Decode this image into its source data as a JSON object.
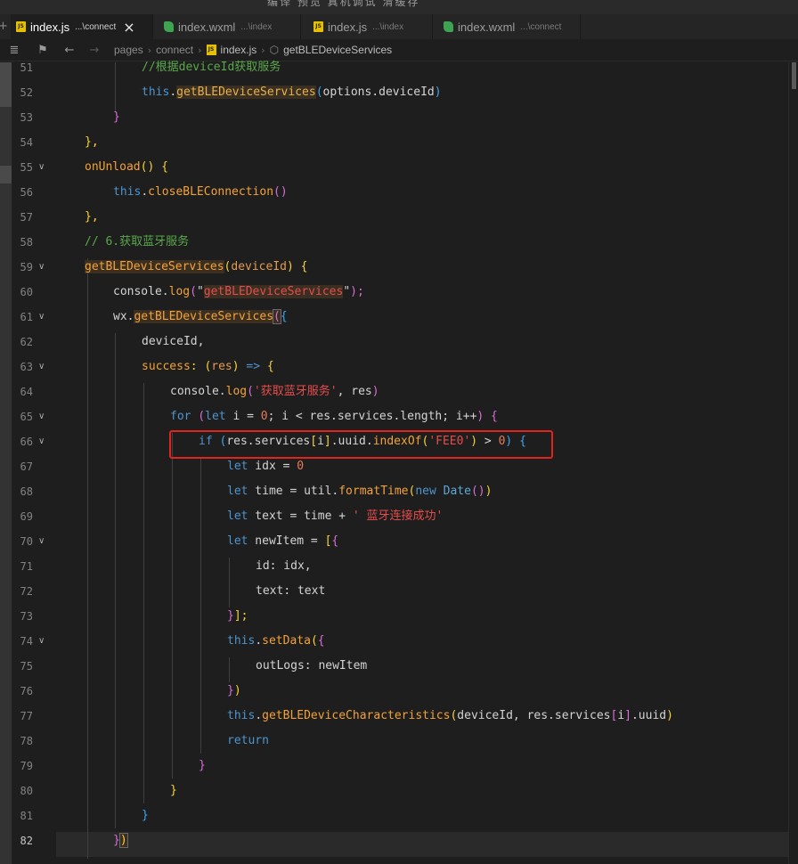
{
  "titlebar": {
    "text": "编译   预览   真机调试  清缓存"
  },
  "tabs": [
    {
      "name": "index.js",
      "path": "...\\connect",
      "icon": "js",
      "close": "×"
    },
    {
      "name": "index.wxml",
      "path": "...\\index",
      "icon": "wxml"
    },
    {
      "name": "index.js",
      "path": "...\\index",
      "icon": "js"
    },
    {
      "name": "index.wxml",
      "path": "...\\connect",
      "icon": "wxml"
    }
  ],
  "breadcrumb": {
    "segments": [
      "pages",
      "connect",
      "index.js"
    ],
    "symbol": "getBLEDeviceServices",
    "separator": "›"
  },
  "icons": {
    "js_badge": "JS",
    "back": "←",
    "forward": "→",
    "bookmark": "⚑",
    "menu": "≣",
    "plus": "+",
    "fold": "∨",
    "cube": "⬡"
  },
  "editor": {
    "current_line": 82,
    "line_numbers": [
      51,
      52,
      53,
      54,
      55,
      56,
      57,
      58,
      59,
      60,
      61,
      62,
      63,
      64,
      65,
      66,
      67,
      68,
      69,
      70,
      71,
      72,
      73,
      74,
      75,
      76,
      77,
      78,
      79,
      80,
      81,
      82
    ],
    "lines": [
      [
        {
          "t": "//根据deviceId获取服务",
          "c": "cm"
        }
      ],
      [
        {
          "t": "this",
          "c": "kw"
        },
        {
          "t": ".",
          "c": "df"
        },
        {
          "t": "getBLEDeviceServices",
          "c": "fn",
          "h": "sym"
        },
        {
          "t": "(",
          "c": "b3"
        },
        {
          "t": "options.deviceId",
          "c": "df"
        },
        {
          "t": ")",
          "c": "b3"
        }
      ],
      [
        {
          "t": "}",
          "c": "b2"
        }
      ],
      [
        {
          "t": "},",
          "c": "b1"
        }
      ],
      [
        {
          "t": "onUnload",
          "c": "ty"
        },
        {
          "t": "() {",
          "c": "b1"
        }
      ],
      [
        {
          "t": "this",
          "c": "kw"
        },
        {
          "t": ".",
          "c": "df"
        },
        {
          "t": "closeBLEConnection",
          "c": "ty"
        },
        {
          "t": "()",
          "c": "b2"
        }
      ],
      [
        {
          "t": "},",
          "c": "b1"
        }
      ],
      [
        {
          "t": "// 6.获取蓝牙服务",
          "c": "cm"
        }
      ],
      [
        {
          "t": "getBLEDeviceServices",
          "c": "ty",
          "h": "sym"
        },
        {
          "t": "(",
          "c": "b1"
        },
        {
          "t": "deviceId",
          "c": "pm"
        },
        {
          "t": ") {",
          "c": "b1"
        }
      ],
      [
        {
          "t": "console",
          "c": "df"
        },
        {
          "t": ".",
          "c": "df"
        },
        {
          "t": "log",
          "c": "ty"
        },
        {
          "t": "(",
          "c": "b2"
        },
        {
          "t": "\"",
          "c": "df"
        },
        {
          "t": "getBLEDeviceServices",
          "c": "st",
          "h": "sym"
        },
        {
          "t": "\"",
          "c": "df"
        },
        {
          "t": ");",
          "c": "b2"
        }
      ],
      [
        {
          "t": "wx",
          "c": "df"
        },
        {
          "t": ".",
          "c": "df"
        },
        {
          "t": "getBLEDeviceServices",
          "c": "ty",
          "h": "sym"
        },
        {
          "t": "(",
          "c": "b2",
          "h": "br"
        },
        {
          "t": "{",
          "c": "b3"
        }
      ],
      [
        {
          "t": "deviceId,",
          "c": "df"
        }
      ],
      [
        {
          "t": "success",
          "c": "ty"
        },
        {
          "t": ": (",
          "c": "b1"
        },
        {
          "t": "res",
          "c": "pm"
        },
        {
          "t": ") ",
          "c": "b1"
        },
        {
          "t": "=>",
          "c": "kw"
        },
        {
          "t": " {",
          "c": "b1"
        }
      ],
      [
        {
          "t": "console",
          "c": "df"
        },
        {
          "t": ".",
          "c": "df"
        },
        {
          "t": "log",
          "c": "ty"
        },
        {
          "t": "(",
          "c": "b2"
        },
        {
          "t": "'获取蓝牙服务'",
          "c": "st"
        },
        {
          "t": ", res",
          "c": "df"
        },
        {
          "t": ")",
          "c": "b2"
        }
      ],
      [
        {
          "t": "for",
          "c": "kw"
        },
        {
          "t": " (",
          "c": "b2"
        },
        {
          "t": "let",
          "c": "kw"
        },
        {
          "t": " i = ",
          "c": "df"
        },
        {
          "t": "0",
          "c": "nm"
        },
        {
          "t": "; i < res.services.length; i++",
          "c": "df"
        },
        {
          "t": ") {",
          "c": "b2"
        }
      ],
      [
        {
          "t": "if",
          "c": "kw"
        },
        {
          "t": " (",
          "c": "b3"
        },
        {
          "t": "res.services",
          "c": "df"
        },
        {
          "t": "[",
          "c": "b1"
        },
        {
          "t": "i",
          "c": "df"
        },
        {
          "t": "]",
          "c": "b1"
        },
        {
          "t": ".uuid.",
          "c": "df"
        },
        {
          "t": "indexOf",
          "c": "ty"
        },
        {
          "t": "(",
          "c": "b1"
        },
        {
          "t": "'FEE0'",
          "c": "st"
        },
        {
          "t": ")",
          "c": "b1"
        },
        {
          "t": " > ",
          "c": "df"
        },
        {
          "t": "0",
          "c": "nm"
        },
        {
          "t": ")",
          "c": "b3"
        },
        {
          "t": " {",
          "c": "b3"
        }
      ],
      [
        {
          "t": "let",
          "c": "kw"
        },
        {
          "t": " idx = ",
          "c": "df"
        },
        {
          "t": "0",
          "c": "nm"
        }
      ],
      [
        {
          "t": "let",
          "c": "kw"
        },
        {
          "t": " time = util.",
          "c": "df"
        },
        {
          "t": "formatTime",
          "c": "ty"
        },
        {
          "t": "(",
          "c": "b1"
        },
        {
          "t": "new",
          "c": "kw"
        },
        {
          "t": " ",
          "c": "df"
        },
        {
          "t": "Date",
          "c": "pp"
        },
        {
          "t": "()",
          "c": "b2"
        },
        {
          "t": ")",
          "c": "b1"
        }
      ],
      [
        {
          "t": "let",
          "c": "kw"
        },
        {
          "t": " text = time + ",
          "c": "df"
        },
        {
          "t": "' 蓝牙连接成功'",
          "c": "st"
        }
      ],
      [
        {
          "t": "let",
          "c": "kw"
        },
        {
          "t": " newItem = ",
          "c": "df"
        },
        {
          "t": "[",
          "c": "b1"
        },
        {
          "t": "{",
          "c": "b2"
        }
      ],
      [
        {
          "t": "id",
          "c": "df"
        },
        {
          "t": ": idx,",
          "c": "df"
        }
      ],
      [
        {
          "t": "text",
          "c": "df"
        },
        {
          "t": ": text",
          "c": "df"
        }
      ],
      [
        {
          "t": "}",
          "c": "b2"
        },
        {
          "t": "];",
          "c": "b1"
        }
      ],
      [
        {
          "t": "this",
          "c": "kw"
        },
        {
          "t": ".",
          "c": "df"
        },
        {
          "t": "setData",
          "c": "ty"
        },
        {
          "t": "(",
          "c": "b1"
        },
        {
          "t": "{",
          "c": "b2"
        }
      ],
      [
        {
          "t": "outLogs",
          "c": "df"
        },
        {
          "t": ": newItem",
          "c": "df"
        }
      ],
      [
        {
          "t": "}",
          "c": "b2"
        },
        {
          "t": ")",
          "c": "b1"
        }
      ],
      [
        {
          "t": "this",
          "c": "kw"
        },
        {
          "t": ".",
          "c": "df"
        },
        {
          "t": "getBLEDeviceCharacteristics",
          "c": "ty"
        },
        {
          "t": "(",
          "c": "b1"
        },
        {
          "t": "deviceId, res.services",
          "c": "df"
        },
        {
          "t": "[",
          "c": "b2"
        },
        {
          "t": "i",
          "c": "df"
        },
        {
          "t": "]",
          "c": "b2"
        },
        {
          "t": ".uuid",
          "c": "df"
        },
        {
          "t": ")",
          "c": "b1"
        }
      ],
      [
        {
          "t": "return",
          "c": "kw"
        }
      ],
      [
        {
          "t": "}",
          "c": "b2"
        }
      ],
      [
        {
          "t": "}",
          "c": "b1"
        }
      ],
      [
        {
          "t": "}",
          "c": "b3"
        }
      ],
      [
        {
          "t": "}",
          "c": "b2"
        },
        {
          "t": ")",
          "c": "b1",
          "h": "br"
        }
      ]
    ]
  },
  "colors": {
    "highlight_box": "#e0241e",
    "editor_bg": "#1e1e1e"
  }
}
